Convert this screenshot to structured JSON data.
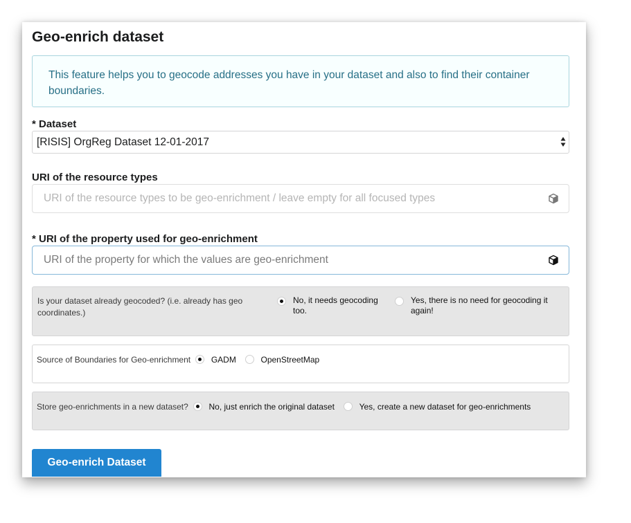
{
  "title": "Geo-enrich dataset",
  "info_message": "This feature helps you to geocode addresses you have in your dataset and also to find their container boundaries.",
  "dataset": {
    "label": "* Dataset",
    "selected": "[RISIS] OrgReg Dataset 12-01-2017"
  },
  "resource_types": {
    "label": "URI of the resource types",
    "placeholder": "URI of the resource types to be geo-enrichment / leave empty for all focused types",
    "icon": "cube-icon"
  },
  "property": {
    "label": "* URI of the property used for geo-enrichment",
    "placeholder": "URI of the property for which the values are geo-enrichment",
    "icon": "cube-icon"
  },
  "geocoded": {
    "question": "Is your dataset already geocoded? (i.e. already has geo coordinates.)",
    "options": [
      {
        "label": "No, it needs geocoding too.",
        "checked": true
      },
      {
        "label": "Yes, there is no need for geocoding it again!",
        "checked": false
      }
    ]
  },
  "boundaries": {
    "question": "Source of Boundaries for Geo-enrichment",
    "options": [
      {
        "label": "GADM",
        "checked": true
      },
      {
        "label": "OpenStreetMap",
        "checked": false
      }
    ]
  },
  "store": {
    "question": "Store geo-enrichments in a new dataset?",
    "options": [
      {
        "label": "No, just enrich the original dataset",
        "checked": true
      },
      {
        "label": "Yes, create a new dataset for geo-enrichments",
        "checked": false
      }
    ]
  },
  "submit_label": "Geo-enrich Dataset",
  "colors": {
    "info_bg": "#f8ffff",
    "info_text": "#276f86",
    "primary": "#2185d0"
  }
}
